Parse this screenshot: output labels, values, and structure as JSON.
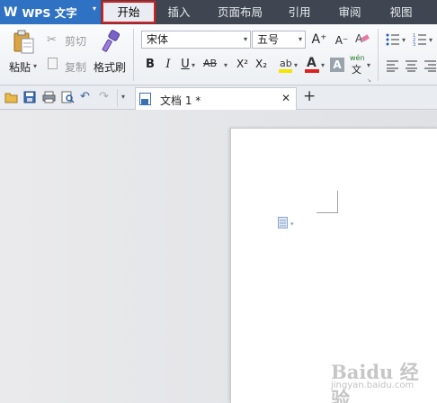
{
  "app": {
    "menu_label": "WPS 文字",
    "logo_glyph": "W",
    "menu_arrow": "▾"
  },
  "tabs": [
    {
      "label": "开始",
      "active": true
    },
    {
      "label": "插入",
      "active": false
    },
    {
      "label": "页面布局",
      "active": false
    },
    {
      "label": "引用",
      "active": false
    },
    {
      "label": "审阅",
      "active": false
    },
    {
      "label": "视图",
      "active": false
    }
  ],
  "colors": {
    "menubar": "#3f4651",
    "app_menu": "#2f72c4",
    "highlight_border": "#e01c1c",
    "font_color_bar": "#e02020",
    "highlight_color_bar": "#f5e600"
  },
  "clipboard": {
    "paste_label": "粘贴",
    "cut_label": "剪切",
    "copy_label": "复制",
    "format_painter_label": "格式刷"
  },
  "font": {
    "family": "宋体",
    "size": "五号",
    "size_dropdown": "▾",
    "family_dropdown": "▾"
  },
  "format_buttons": {
    "bold": "B",
    "italic": "I",
    "underline": "U",
    "strike": "AB",
    "superscript": "X²",
    "subscript": "X₂",
    "font_color": "A",
    "char_shade": "A",
    "phonetic_top": "wén",
    "phonetic_bottom": "文",
    "grow": "A⁺",
    "shrink": "A⁻"
  },
  "quick_toolbar": {
    "icons": [
      "open-icon",
      "save-icon",
      "print-icon",
      "print-preview-icon",
      "undo-icon",
      "redo-icon",
      "customize-icon"
    ]
  },
  "document_tab": {
    "label": "文档 1 *",
    "close_glyph": "✕",
    "new_tab_glyph": "+"
  },
  "watermark": {
    "line1": "Baidu 经验",
    "line2": "jingyan.baidu.com"
  }
}
